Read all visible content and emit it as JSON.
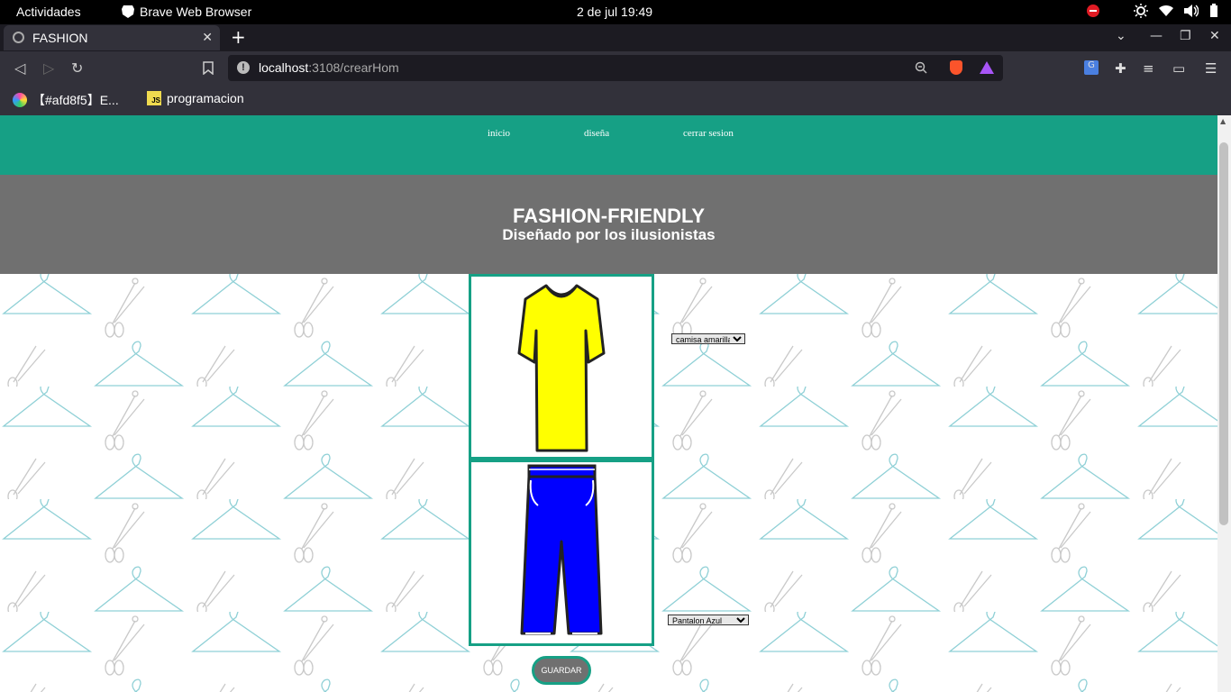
{
  "system": {
    "activities": "Actividades",
    "app_name": "Brave Web Browser",
    "clock": "2 de jul  19:49"
  },
  "browser": {
    "tab_title": "FASHION",
    "url_host": "localhost",
    "url_rest": ":3108/crearHom",
    "bookmarks": [
      {
        "label": "【#afd8f5】E..."
      },
      {
        "label": "programacion"
      }
    ]
  },
  "site": {
    "nav": [
      {
        "label": "inicio"
      },
      {
        "label": "diseña"
      },
      {
        "label": "cerrar sesion"
      }
    ],
    "title": "FASHION-FRIENDLY",
    "subtitle": "Diseñado por los ilusionistas",
    "shirt_select": {
      "value": "camisa amarilla",
      "options": [
        "camisa amarilla"
      ]
    },
    "pants_select": {
      "value": "Pantalon Azul",
      "options": [
        "Pantalon Azul"
      ]
    },
    "save_label": "GUARDAR",
    "colors": {
      "accent": "#16a085",
      "hero": "#707070",
      "shirt": "#ffff00",
      "pants": "#0000ff",
      "pattern": "#8fd0d6"
    }
  }
}
